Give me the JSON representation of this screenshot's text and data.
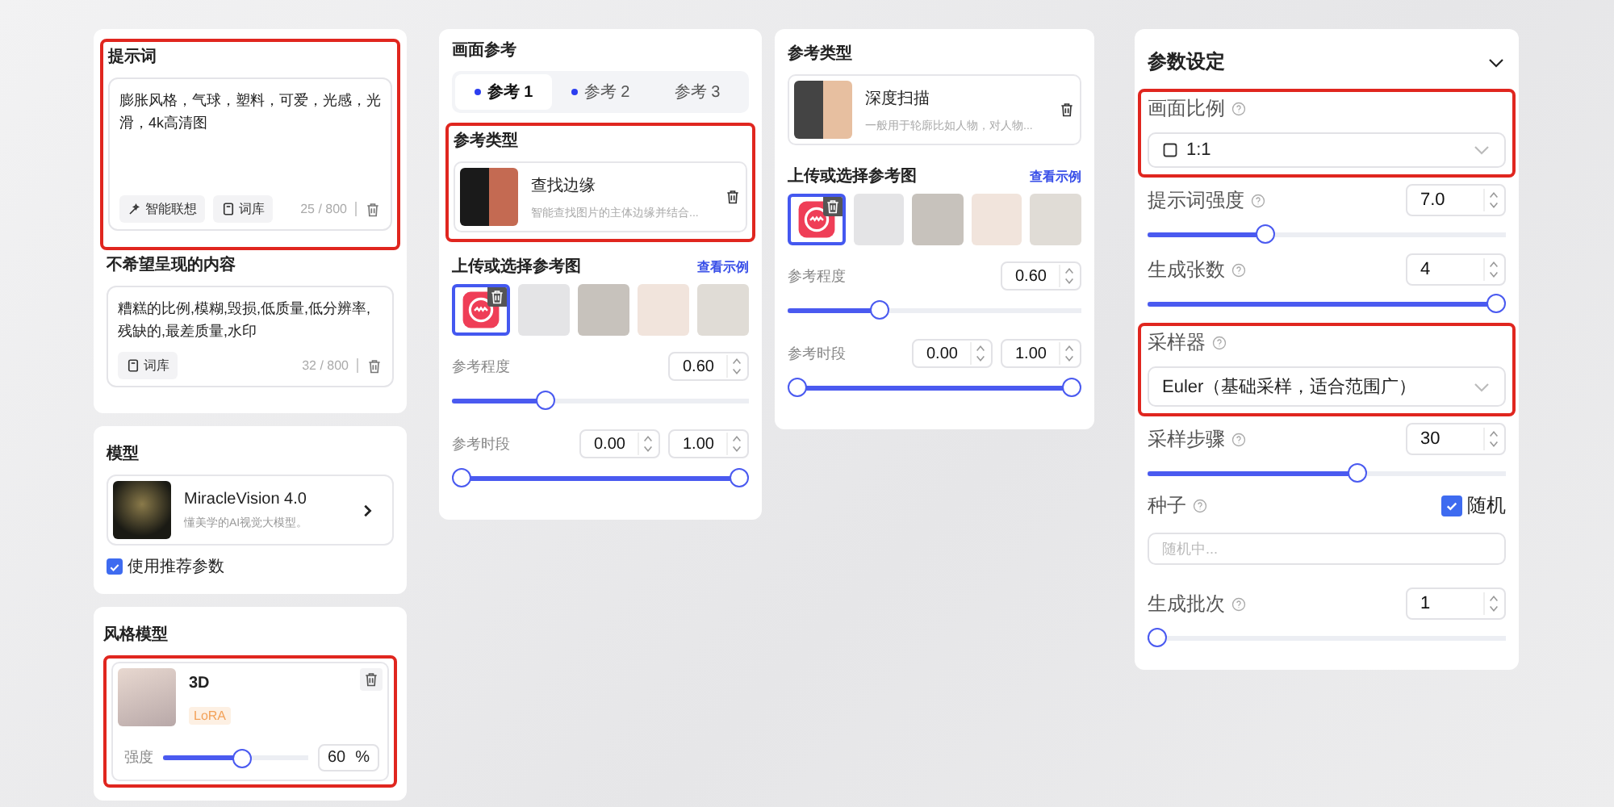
{
  "prompt_panel": {
    "prompt": {
      "title": "提示词",
      "text": "膨胀风格，气球，塑料，可爱，光感，光滑，4k高清图",
      "highlighted": true,
      "tools": [
        {
          "kind": "suggest",
          "label": "智能联想"
        },
        {
          "kind": "library",
          "label": "词库"
        }
      ],
      "count": "25 / 800"
    },
    "negative": {
      "title": "不希望呈现的内容",
      "text": "糟糕的比例,模糊,毁损,低质量,低分辨率,残缺的,最差质量,水印",
      "tools": [
        {
          "kind": "library",
          "label": "词库"
        }
      ],
      "count": "32 / 800"
    }
  },
  "model_panel": {
    "title": "模型",
    "name": "MiracleVision 4.0",
    "description": "懂美学的AI视觉大模型。",
    "recommended": {
      "label": "使用推荐参数",
      "checked": true
    }
  },
  "style_panel": {
    "title": "风格模型",
    "highlighted": true,
    "model": {
      "name": "3D",
      "tag": "LoRA"
    },
    "strength": {
      "label": "强度",
      "level": 0.55,
      "value": "60",
      "unit": "%"
    }
  },
  "reference_panels": [
    {
      "title": "画面参考",
      "tabs": [
        {
          "label": "参考 1",
          "selected": true,
          "marked": true
        },
        {
          "label": "参考 2",
          "selected": false,
          "marked": true
        },
        {
          "label": "参考 3",
          "selected": false,
          "marked": false
        }
      ],
      "type": {
        "title": "参考类型",
        "highlighted": true,
        "name": "查找边缘",
        "description": "智能查找图片的主体边缘并结合..."
      },
      "upload": {
        "title": "上传或选择参考图",
        "link": "查看示例",
        "images": [
          {
            "kind": "logo",
            "selected": true
          },
          {
            "kind": "photo",
            "selected": false
          },
          {
            "kind": "photo",
            "selected": false
          },
          {
            "kind": "photo",
            "selected": false
          },
          {
            "kind": "photo",
            "selected": false
          }
        ]
      },
      "strength": {
        "label": "参考程度",
        "value": "0.60",
        "level": 0.3
      },
      "period": {
        "label": "参考时段",
        "handles": [
          {
            "value": "0.00",
            "level": 0
          },
          {
            "value": "1.00",
            "level": 1
          }
        ]
      }
    },
    {
      "type": {
        "title": "参考类型",
        "name": "深度扫描",
        "description": "一般用于轮廓比如人物，对人物..."
      },
      "upload": {
        "title": "上传或选择参考图",
        "link": "查看示例",
        "images": [
          {
            "kind": "logo",
            "selected": true
          },
          {
            "kind": "photo",
            "selected": false
          },
          {
            "kind": "photo",
            "selected": false
          },
          {
            "kind": "photo",
            "selected": false
          },
          {
            "kind": "photo",
            "selected": false
          }
        ]
      },
      "strength": {
        "label": "参考程度",
        "value": "0.60",
        "level": 0.3
      },
      "period": {
        "label": "参考时段",
        "handles": [
          {
            "value": "0.00",
            "level": 0
          },
          {
            "value": "1.00",
            "level": 1
          }
        ]
      }
    }
  ],
  "settings": {
    "title": "参数设定",
    "expanded": true,
    "items": [
      {
        "kind": "select",
        "label": "画面比例",
        "value": "1:1",
        "square": true,
        "highlighted": true
      },
      {
        "kind": "slider",
        "label": "提示词强度",
        "value": "7.0",
        "level": 0.32
      },
      {
        "kind": "slider",
        "label": "生成张数",
        "value": "4",
        "level": 1
      },
      {
        "kind": "select",
        "label": "采样器",
        "value": "Euler（基础采样，适合范围广）",
        "highlighted": true
      },
      {
        "kind": "slider",
        "label": "采样步骤",
        "value": "30",
        "level": 0.59
      },
      {
        "kind": "seed",
        "label": "种子",
        "checkbox": {
          "label": "随机",
          "checked": true
        },
        "placeholder": "随机中..."
      },
      {
        "kind": "slider",
        "label": "生成批次",
        "value": "1",
        "level": 0
      }
    ]
  }
}
